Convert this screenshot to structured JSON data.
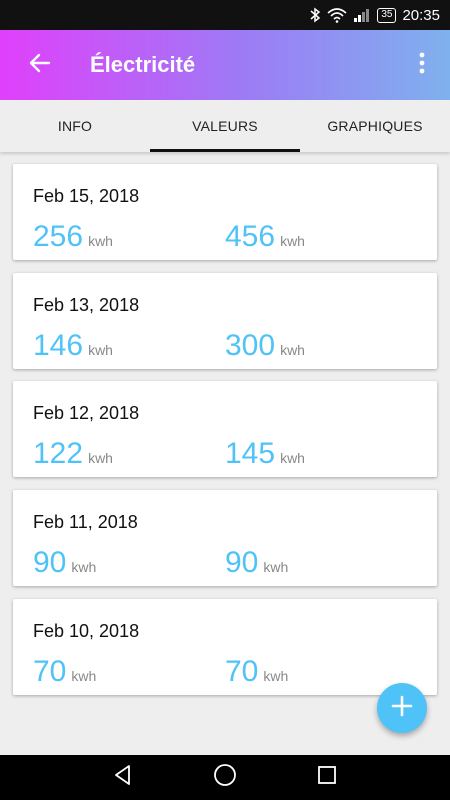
{
  "status_bar": {
    "battery": "35",
    "time": "20:35"
  },
  "app_bar": {
    "title": "Électricité",
    "back_icon": "arrow-left-icon",
    "menu_icon": "more-vert-icon"
  },
  "tabs": [
    {
      "label": "INFO",
      "active": false
    },
    {
      "label": "VALEURS",
      "active": true
    },
    {
      "label": "GRAPHIQUES",
      "active": false
    }
  ],
  "entries": [
    {
      "date": "Feb 15, 2018",
      "value1": "256",
      "unit1": "kwh",
      "value2": "456",
      "unit2": "kwh"
    },
    {
      "date": "Feb 13, 2018",
      "value1": "146",
      "unit1": "kwh",
      "value2": "300",
      "unit2": "kwh"
    },
    {
      "date": "Feb 12, 2018",
      "value1": "122",
      "unit1": "kwh",
      "value2": "145",
      "unit2": "kwh"
    },
    {
      "date": "Feb 11, 2018",
      "value1": "90",
      "unit1": "kwh",
      "value2": "90",
      "unit2": "kwh"
    },
    {
      "date": "Feb 10, 2018",
      "value1": "70",
      "unit1": "kwh",
      "value2": "70",
      "unit2": "kwh"
    }
  ],
  "fab": {
    "icon": "plus-icon"
  },
  "colors": {
    "accent": "#4fc3f7",
    "appbar_gradient_start": "#e040fb",
    "appbar_gradient_end": "#7fb1ee"
  }
}
